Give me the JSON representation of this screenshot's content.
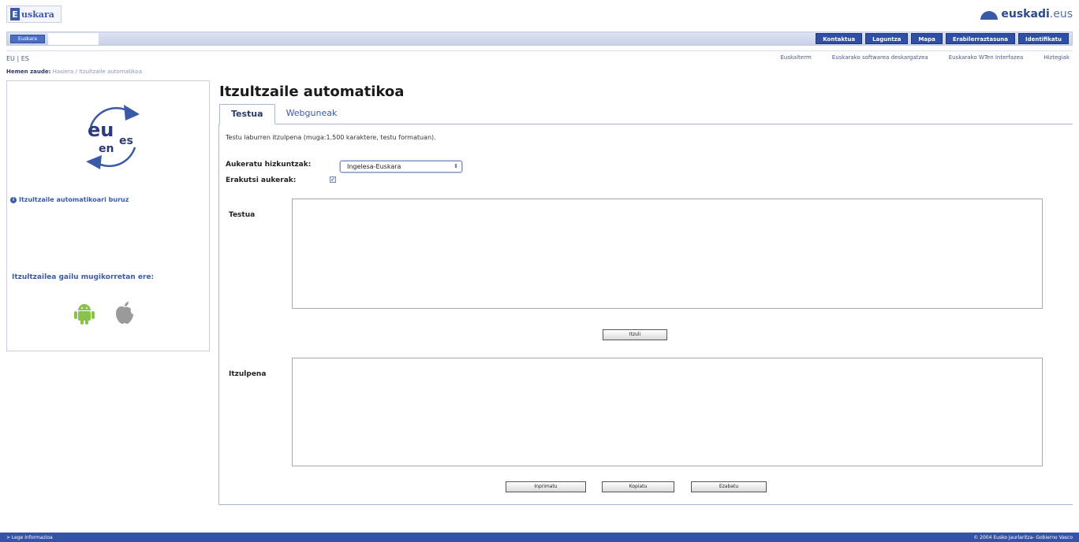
{
  "header": {
    "logo_letter": "E",
    "logo_rest": "uskara",
    "brand_main": "euskadi",
    "brand_suffix": ".eus",
    "small_button": "Euskara",
    "nav": [
      "Kontaktua",
      "Laguntza",
      "Mapa",
      "Erabilerraztasuna",
      "Identifikatu"
    ],
    "languages": "EU | ES",
    "sublinks": [
      "Euskalterm",
      "Euskarako softwarea deskargatzea",
      "Euskarako WTen Interfazea",
      "Hiztegiak"
    ]
  },
  "breadcrumb": {
    "label": "Hemen zaude:",
    "path": "Hasiera / Itzultzaile automatikoa"
  },
  "sidebar": {
    "logo_eu": "eu",
    "logo_es": "es",
    "logo_en": "en",
    "info_icon": "info-icon",
    "info_link": "Itzultzaile automatikoari buruz",
    "mobile_title": "Itzultzailea gailu mugikorretan ere:",
    "apps": [
      "android-icon",
      "apple-icon"
    ],
    "colors": {
      "accent": "#3a5aa8",
      "android": "#8bc34a",
      "apple": "#9a9a9a"
    }
  },
  "main": {
    "title": "Itzultzaile automatikoa",
    "tabs": [
      {
        "label": "Testua",
        "active": true
      },
      {
        "label": "Webguneak",
        "active": false
      }
    ],
    "description": "Testu laburren itzulpena (muga:1.500 karaktere, testu formatuan).",
    "language_label": "Aukeratu hizkuntzak:",
    "language_value": "Ingelesa-Euskara",
    "options_label": "Erakutsi aukerak:",
    "options_checked": true,
    "text_label": "Testua",
    "text_value": "",
    "translate_button": "Itzuli",
    "translation_label": "Itzulpena",
    "translation_value": "",
    "buttons": [
      "Inprimatu",
      "Kopiatu",
      "Ezabatu"
    ]
  },
  "footer": {
    "left": "> Lege Informazioa",
    "right": "© 2004 Eusko Jaurlaritza- Gobierno Vasco"
  }
}
